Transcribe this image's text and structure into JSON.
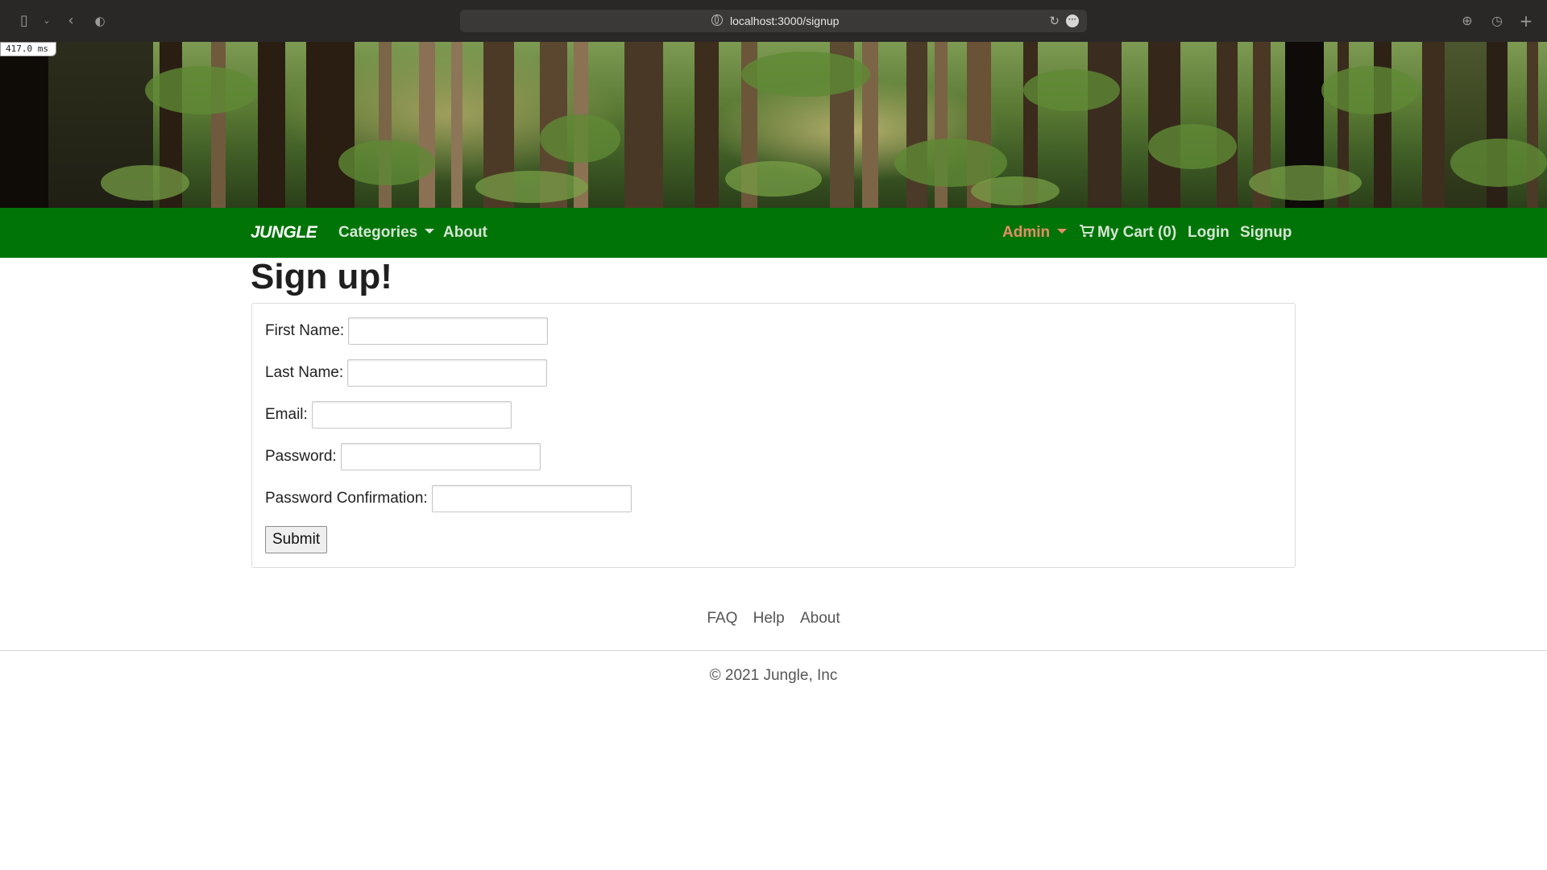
{
  "browser": {
    "url": "localhost:3000/signup",
    "timing": "417.0 ms"
  },
  "nav": {
    "brand": "JUNGLE",
    "categories": "Categories",
    "about": "About",
    "admin": "Admin",
    "cart": "My Cart (0)",
    "login": "Login",
    "signup": "Signup"
  },
  "page": {
    "title": "Sign up!"
  },
  "form": {
    "first_name_label": "First Name:",
    "last_name_label": "Last Name:",
    "email_label": "Email:",
    "password_label": "Password:",
    "password_confirmation_label": "Password Confirmation:",
    "submit_label": "Submit"
  },
  "footer": {
    "links": [
      "FAQ",
      "Help",
      "About"
    ],
    "copyright": "© 2021 Jungle, Inc"
  },
  "colors": {
    "navbar": "#007407",
    "admin_link": "#e58d6a",
    "nav_link": "#d5e6d4"
  },
  "icons": {
    "cart": "shopping-cart-icon",
    "categories_dropdown": "caret-down-icon",
    "admin_dropdown": "caret-down-icon"
  }
}
